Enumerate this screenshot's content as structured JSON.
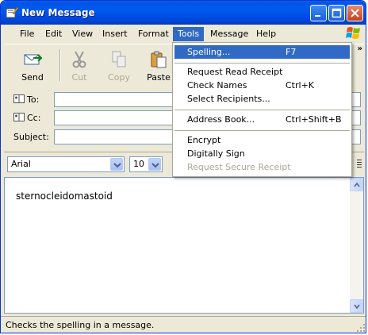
{
  "window": {
    "title": "New Message"
  },
  "menubar": {
    "items": [
      {
        "label": "File"
      },
      {
        "label": "Edit"
      },
      {
        "label": "View"
      },
      {
        "label": "Insert"
      },
      {
        "label": "Format"
      },
      {
        "label": "Tools"
      },
      {
        "label": "Message"
      },
      {
        "label": "Help"
      }
    ]
  },
  "toolbar": {
    "send": "Send",
    "cut": "Cut",
    "copy": "Copy",
    "paste": "Paste"
  },
  "header": {
    "to_label": "To:",
    "cc_label": "Cc:",
    "subject_label": "Subject:",
    "to_value": "",
    "cc_value": "",
    "subject_value": ""
  },
  "format": {
    "font": "Arial",
    "size": "10"
  },
  "body": {
    "text": "sternocleidomastoid"
  },
  "status": {
    "text": "Checks the spelling in a message."
  },
  "tools_menu": {
    "items": [
      {
        "label": "Spelling...",
        "shortcut": "F7",
        "highlighted": true
      },
      {
        "label": "Request Read Receipt",
        "shortcut": ""
      },
      {
        "label": "Check Names",
        "shortcut": "Ctrl+K"
      },
      {
        "label": "Select Recipients...",
        "shortcut": ""
      },
      {
        "label": "Address Book...",
        "shortcut": "Ctrl+Shift+B"
      },
      {
        "label": "Encrypt",
        "shortcut": ""
      },
      {
        "label": "Digitally Sign",
        "shortcut": ""
      },
      {
        "label": "Request Secure Receipt",
        "shortcut": "",
        "disabled": true
      }
    ]
  },
  "colors": {
    "titlebar": "#0055e5",
    "highlight": "#316ac5",
    "chrome": "#ece9d8"
  }
}
